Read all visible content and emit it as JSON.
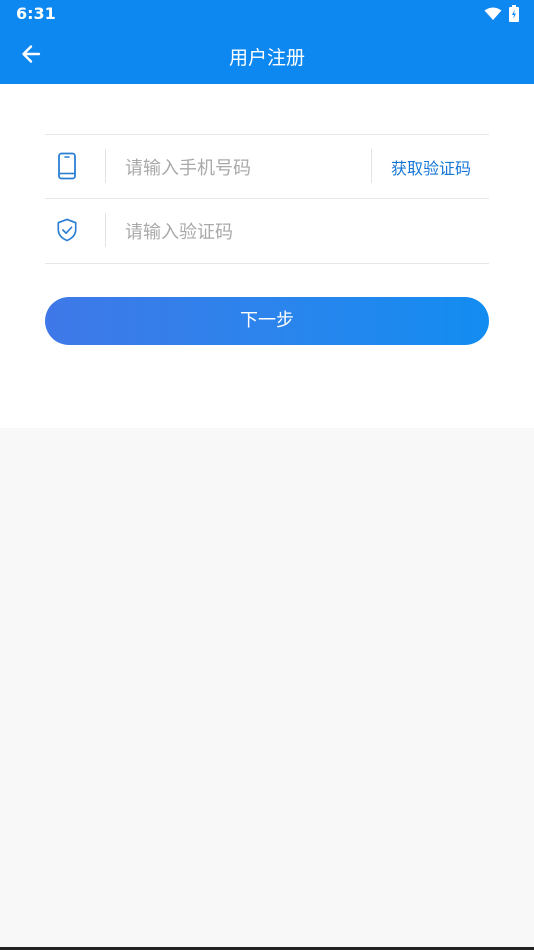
{
  "status_bar": {
    "time": "6:31",
    "wifi_icon": "wifi-icon",
    "battery_icon": "battery-charging-icon"
  },
  "header": {
    "back_icon": "arrow-left-icon",
    "title": "用户注册"
  },
  "form": {
    "phone": {
      "icon": "phone-icon",
      "placeholder": "请输入手机号码",
      "value": "",
      "get_code_label": "获取验证码"
    },
    "code": {
      "icon": "shield-check-icon",
      "placeholder": "请输入验证码",
      "value": ""
    },
    "next_label": "下一步"
  },
  "colors": {
    "header_bg": "#0e88f1",
    "accent": "#1677d6",
    "button_gradient_start": "#3f78e8",
    "button_gradient_end": "#128cf1",
    "page_bg": "#f8f8f8"
  }
}
